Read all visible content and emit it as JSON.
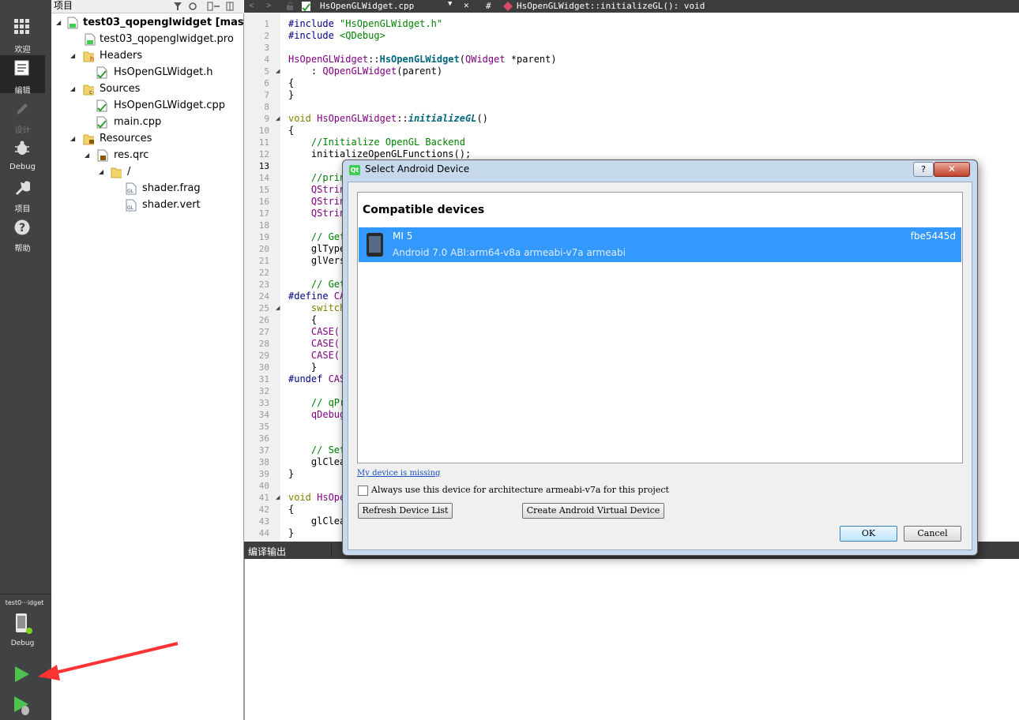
{
  "modebar": {
    "items": [
      {
        "label": "欢迎",
        "icon": "grid-icon"
      },
      {
        "label": "编辑",
        "icon": "document-icon"
      },
      {
        "label": "设计",
        "icon": "pencil-icon"
      },
      {
        "label": "Debug",
        "icon": "bug-icon"
      },
      {
        "label": "项目",
        "icon": "wrench-icon"
      },
      {
        "label": "帮助",
        "icon": "help-icon"
      }
    ],
    "kit_target": "test0···idget",
    "kit_build": "Debug"
  },
  "project_pane": {
    "title": "项目",
    "tree": [
      {
        "label": "test03_qopenglwidget [master]",
        "bold": true
      },
      {
        "label": "test03_qopenglwidget.pro"
      },
      {
        "label": "Headers"
      },
      {
        "label": "HsOpenGLWidget.h"
      },
      {
        "label": "Sources"
      },
      {
        "label": "HsOpenGLWidget.cpp"
      },
      {
        "label": "main.cpp"
      },
      {
        "label": "Resources"
      },
      {
        "label": "res.qrc"
      },
      {
        "label": "/"
      },
      {
        "label": "shader.frag"
      },
      {
        "label": "shader.vert"
      }
    ]
  },
  "editor": {
    "file_name": "HsOpenGLWidget.cpp",
    "hash": "#",
    "function_path": "HsOpenGLWidget::initializeGL(): void",
    "line_numbers": [
      "1",
      "2",
      "3",
      "4",
      "5",
      "6",
      "7",
      "8",
      "9",
      "10",
      "11",
      "12",
      "13",
      "14",
      "15",
      "16",
      "17",
      "18",
      "19",
      "20",
      "21",
      "22",
      "23",
      "24",
      "25",
      "26",
      "27",
      "28",
      "29",
      "30",
      "31",
      "32",
      "33",
      "34",
      "35",
      "36",
      "37",
      "38",
      "39",
      "40",
      "41",
      "42",
      "43",
      "44"
    ]
  },
  "code": {
    "l1_pp": "#include ",
    "l1_str": "\"HsOpenGLWidget.h\"",
    "l2_pp": "#include ",
    "l2_str": "<QDebug>",
    "l4_a": "HsOpenGLWidget",
    "l4_b": "::",
    "l4_c": "HsOpenGLWidget",
    "l4_d": "(",
    "l4_e": "QWidget",
    "l4_f": " *parent)",
    "l5_a": "    : ",
    "l5_b": "QOpenGLWidget",
    "l5_c": "(parent)",
    "l6": "{",
    "l7": "}",
    "l9_a": "void ",
    "l9_b": "HsOpenGLWidget",
    "l9_c": "::",
    "l9_d": "initializeGL",
    "l9_e": "()",
    "l10": "{",
    "l11": "    //Initialize OpenGL Backend",
    "l12": "    initializeOpenGLFunctions();",
    "l14": "    //prin",
    "l15_a": "    ",
    "l15_b": "QStrin",
    "l16_a": "    ",
    "l16_b": "QStrin",
    "l17_a": "    ",
    "l17_b": "QStrin",
    "l19": "    // Get",
    "l20": "    glType",
    "l21": "    glVers",
    "l23": "    // Get",
    "l24_a": "#define ",
    "l24_b": "CA",
    "l25_a": "    ",
    "l25_b": "switch",
    "l26": "    {",
    "l27_a": "    ",
    "l27_b": "CASE(",
    "l28_a": "    ",
    "l28_b": "CASE(",
    "l29_a": "    ",
    "l29_b": "CASE(",
    "l30": "    }",
    "l31_a": "#undef ",
    "l31_b": "CAS",
    "l33": "    // qPr",
    "l34_a": "    ",
    "l34_b": "qDebug",
    "l37": "    // Set",
    "l38": "    glClea",
    "l39": "}",
    "l41_a": "void ",
    "l41_b": "HsOpe",
    "l42": "{",
    "l43": "    glClea",
    "l44": "}"
  },
  "output": {
    "title": "编译输出"
  },
  "dialog": {
    "title": "Select Android Device",
    "help_label": "?",
    "close_label": "✕",
    "section_header": "Compatible devices",
    "device": {
      "name": "MI 5",
      "serial": "fbe5445d",
      "details": "Android 7.0  ABI:arm64-v8a armeabi-v7a armeabi"
    },
    "missing_link": "My device is missing",
    "always_use_label": "Always use this device for architecture armeabi-v7a for this project",
    "always_use_checked": false,
    "refresh_button": "Refresh Device List",
    "create_avd_button": "Create Android Virtual Device",
    "ok_button": "OK",
    "cancel_button": "Cancel"
  },
  "colors": {
    "selection": "#3399ff",
    "modebar": "#404244",
    "annotation_arrow": "#ff3333"
  }
}
